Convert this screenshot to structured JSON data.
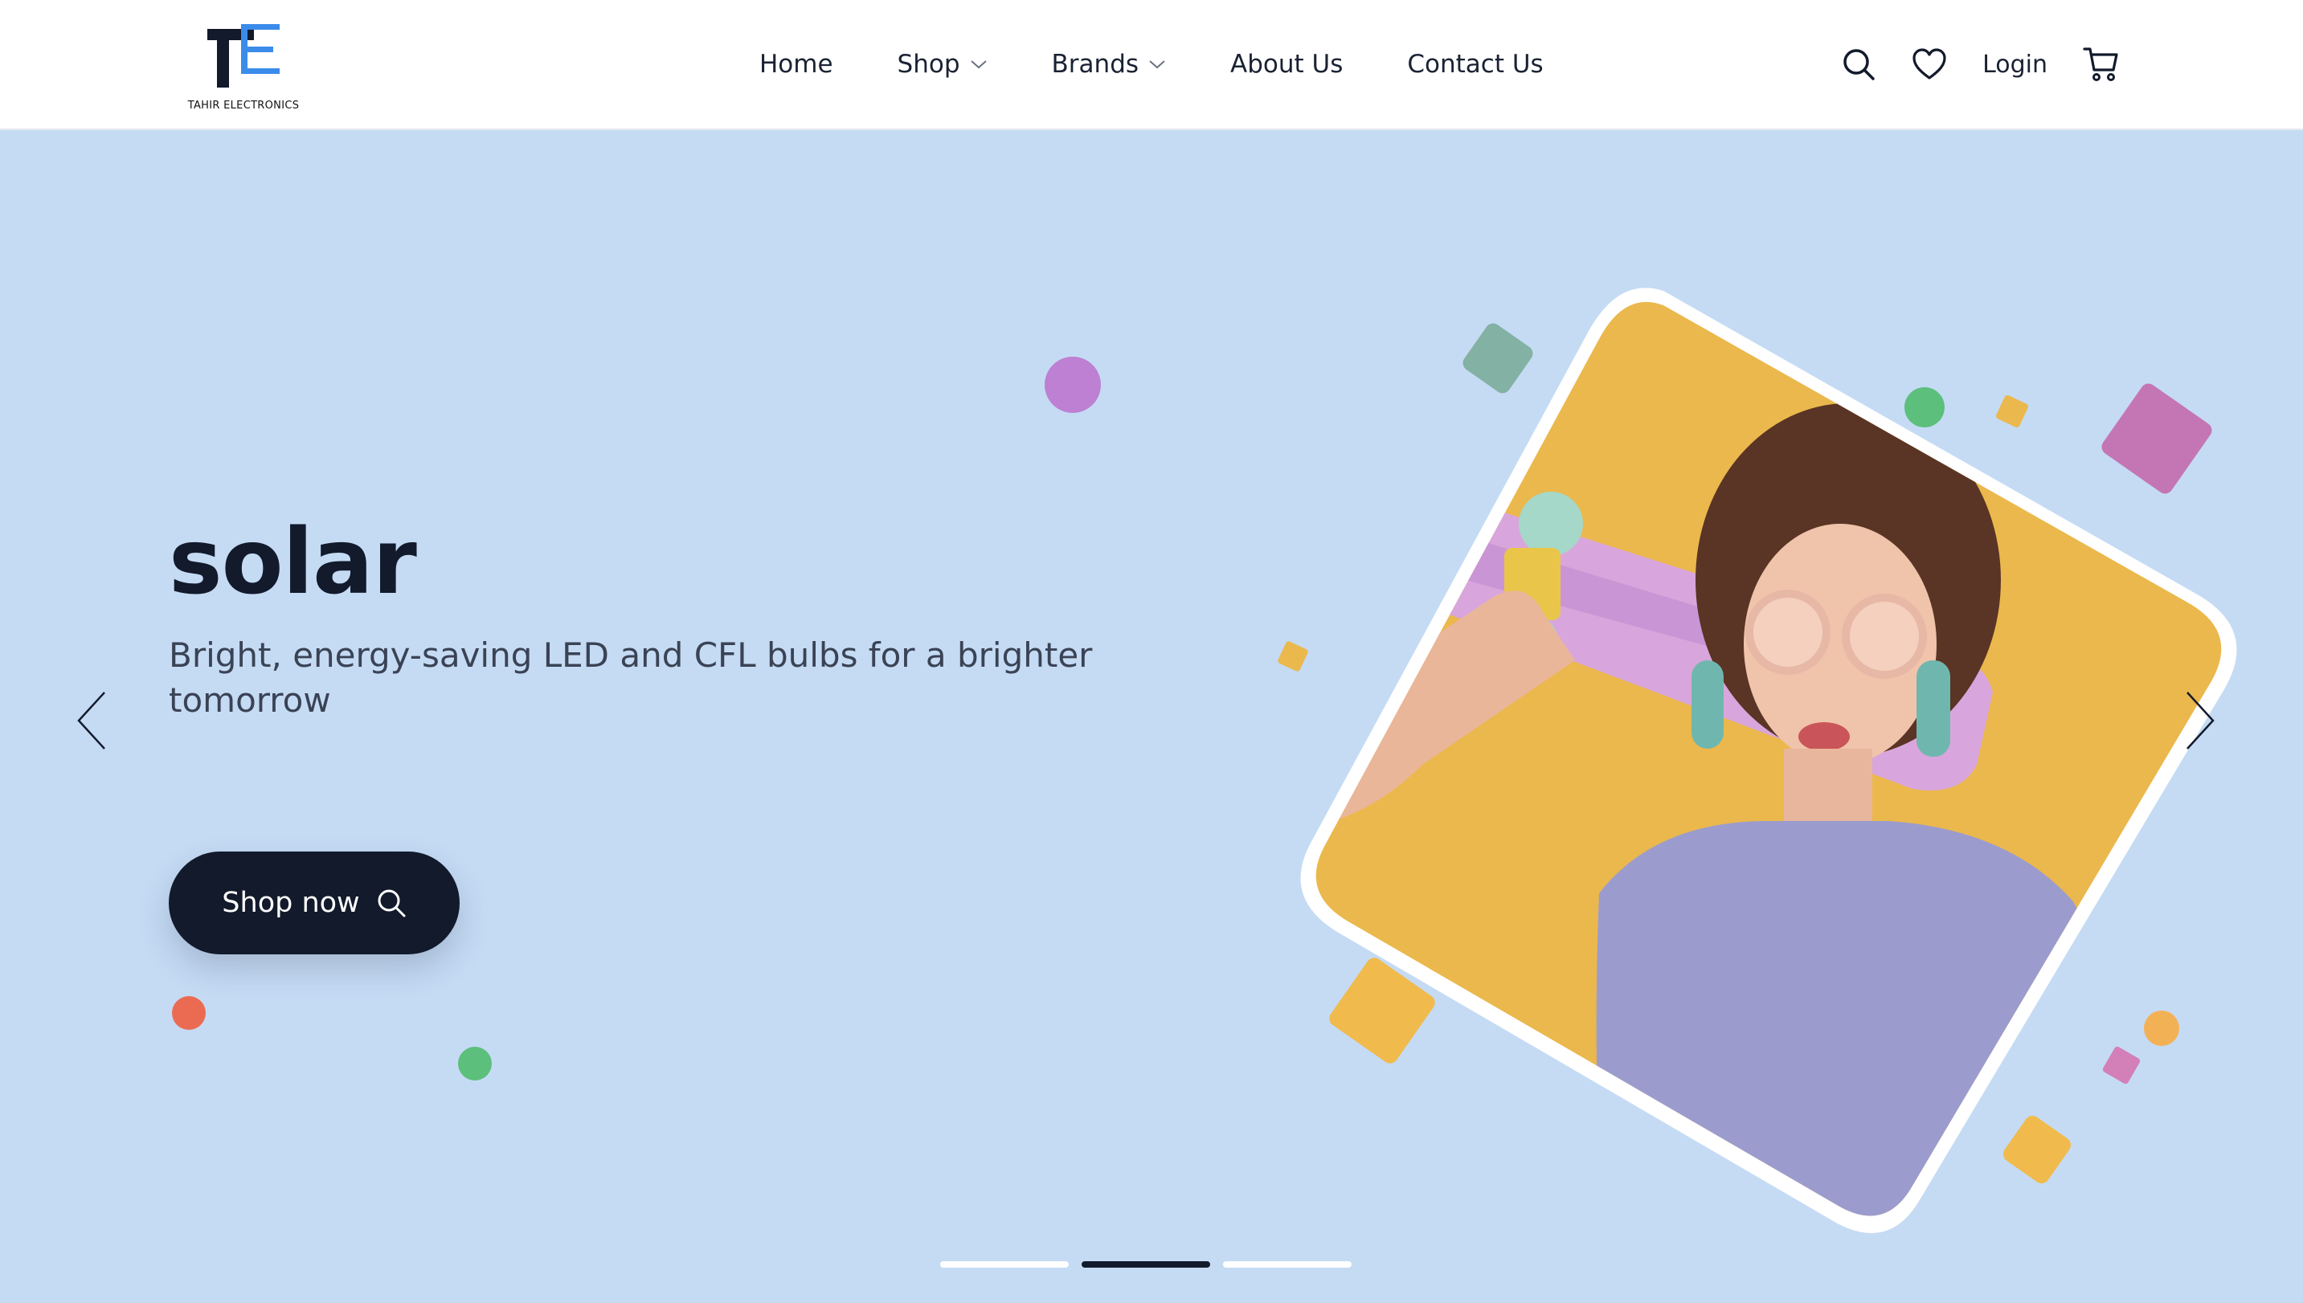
{
  "brand": {
    "logo_text": "TAHIR ELECTRONICS",
    "colors": {
      "dark": "#121a2b",
      "blue": "#3b8beb"
    }
  },
  "nav": {
    "items": [
      {
        "label": "Home",
        "has_dropdown": false
      },
      {
        "label": "Shop",
        "has_dropdown": true
      },
      {
        "label": "Brands",
        "has_dropdown": true
      },
      {
        "label": "About Us",
        "has_dropdown": false
      },
      {
        "label": "Contact Us",
        "has_dropdown": false
      }
    ]
  },
  "header_actions": {
    "search_icon": "search-icon",
    "wishlist_icon": "heart-icon",
    "login_label": "Login",
    "cart_icon": "cart-icon"
  },
  "hero": {
    "title": "solar",
    "subtitle": "Bright, energy-saving LED and CFL bulbs for a brighter tomorrow",
    "cta_label": "Shop now",
    "cta_icon": "search-icon",
    "prev_icon": "chevron-left-icon",
    "next_icon": "chevron-right-icon",
    "background": "#c5dbf4",
    "image_frame_color": "#ebb84d"
  },
  "slider": {
    "count": 3,
    "active_index": 1
  }
}
